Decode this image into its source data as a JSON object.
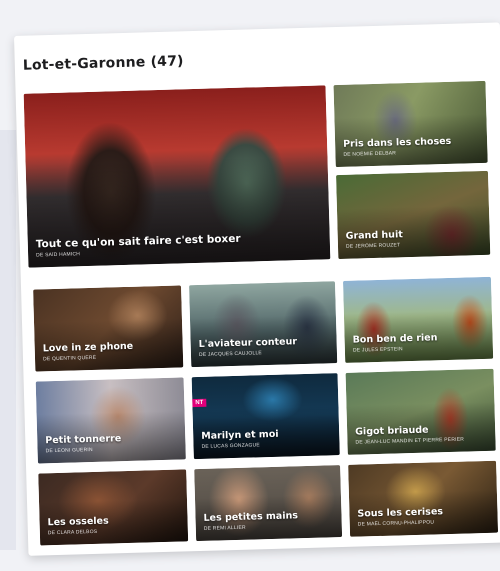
{
  "section": {
    "title": "Lot-et-Garonne (47)"
  },
  "tiles": [
    {
      "title": "Tout ce qu'on sait faire c'est boxer",
      "subtitle": "DE SAÏD HAMICH"
    },
    {
      "title": "Pris dans les choses",
      "subtitle": "DE NOÉMIE DELBAR"
    },
    {
      "title": "Grand huit",
      "subtitle": "DE JÉRÔME ROUZET"
    },
    {
      "title": "Love in ze phone",
      "subtitle": "DE QUENTIN QUÉRÉ"
    },
    {
      "title": "L'aviateur conteur",
      "subtitle": "DE JACQUES CAUJOLLE"
    },
    {
      "title": "Bon ben de rien",
      "subtitle": "DE JULES EPSTEIN"
    },
    {
      "title": "Petit tonnerre",
      "subtitle": "DE LÉONI GUERIN"
    },
    {
      "title": "Marilyn et moi",
      "subtitle": "DE LUCAS GONZAGUE",
      "tag": "NT"
    },
    {
      "title": "Gigot briaude",
      "subtitle": "DE JEAN-LUC MANDIN ET PIERRE PÉRIER"
    },
    {
      "title": "Les osseles",
      "subtitle": "DE CLARA DELBOS"
    },
    {
      "title": "Les petites mains",
      "subtitle": "DE RÉMI ALLIER"
    },
    {
      "title": "Sous les cerises",
      "subtitle": "DE MAËL CORNU-PHALIPPOU"
    }
  ]
}
